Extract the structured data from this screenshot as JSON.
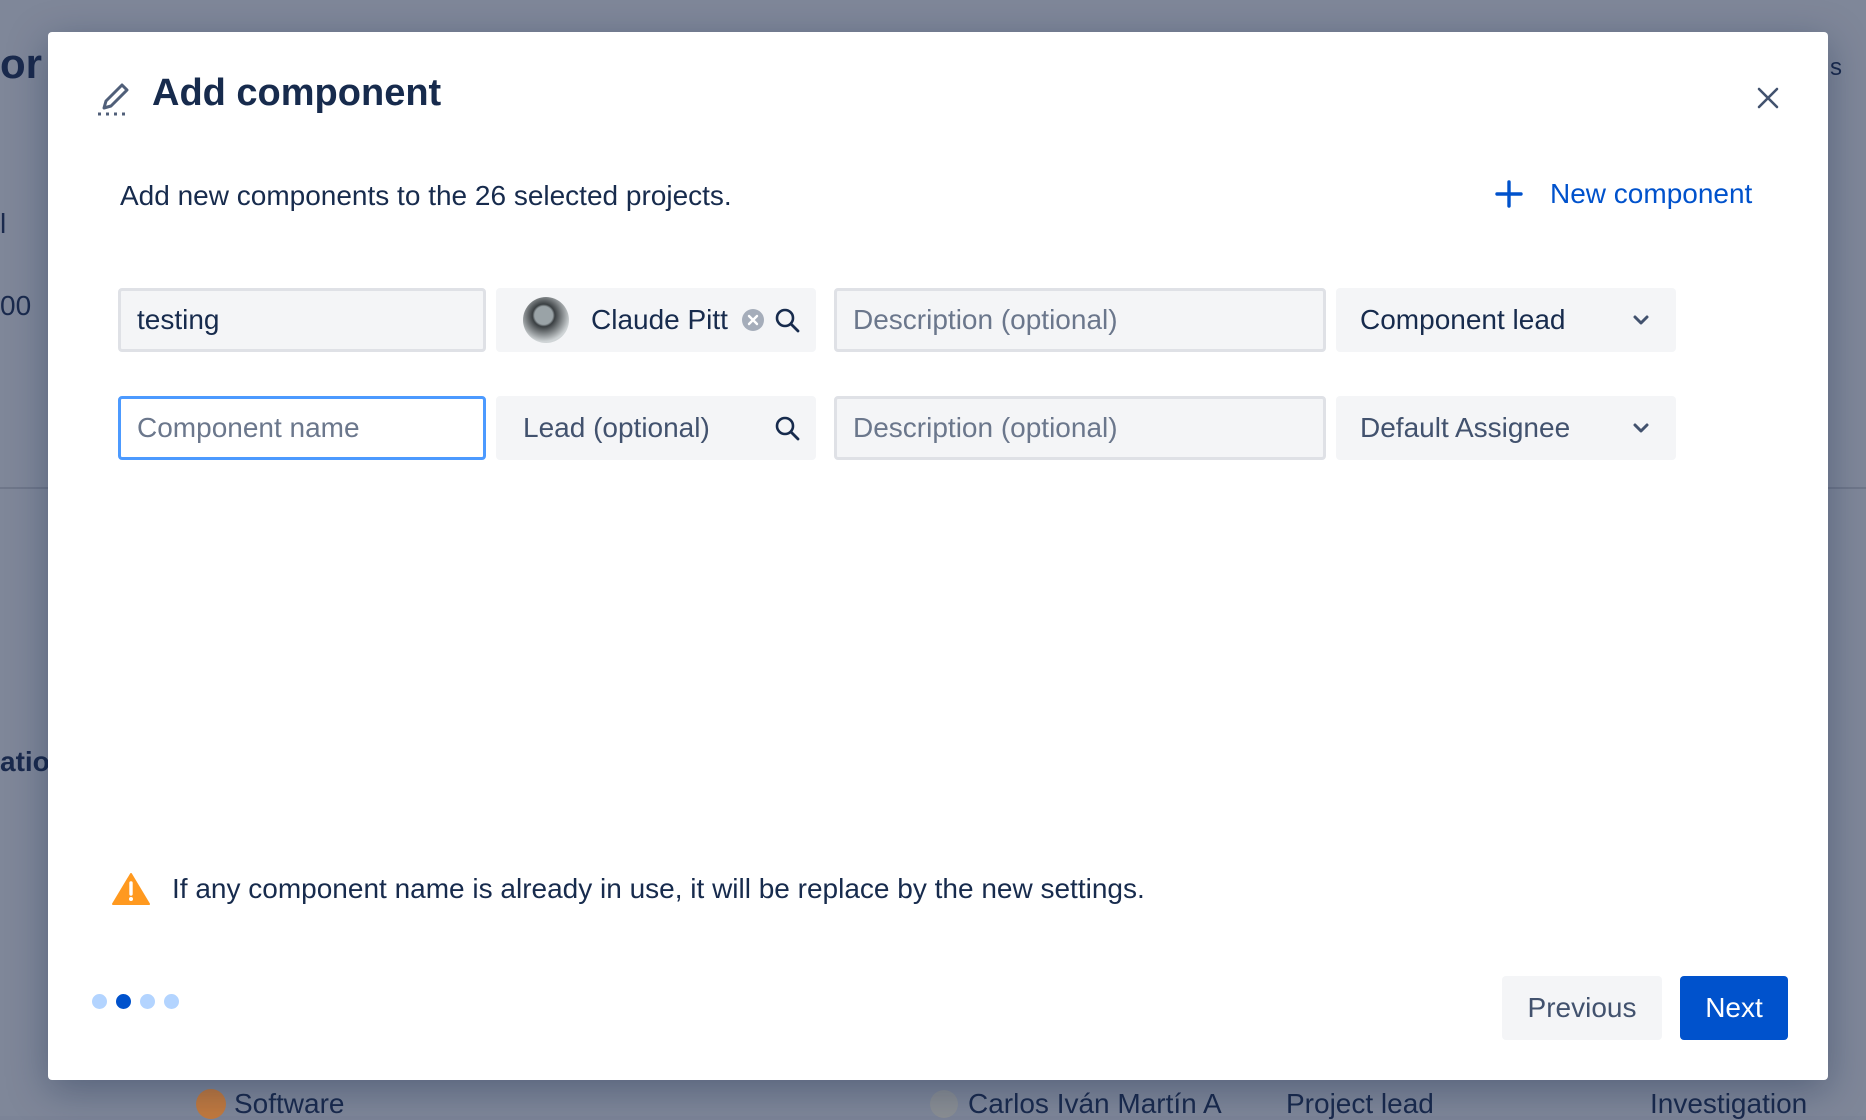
{
  "background": {
    "fragments": [
      "or",
      "l",
      "00",
      "atio",
      "s"
    ],
    "footer": {
      "software": "Software",
      "person": "Carlos Iván Martín A",
      "role": "Project lead",
      "category": "Investigation"
    }
  },
  "dialog": {
    "icon": "edit-pencil-icon",
    "title": "Add component",
    "intro": "Add new components to the 26 selected projects.",
    "new_component_label": "New component",
    "rows": [
      {
        "name_value": "testing",
        "name_placeholder": "Component name",
        "lead_value": "Claude Pitt",
        "description_placeholder": "Description (optional)",
        "assignee_value": "Component lead"
      },
      {
        "name_value": "",
        "name_placeholder": "Component name",
        "lead_placeholder": "Lead (optional)",
        "description_placeholder": "Description (optional)",
        "assignee_value": "Default Assignee"
      }
    ],
    "warning": "If any component name is already in use, it will be replace by the new settings.",
    "steps": {
      "total": 4,
      "current": 2
    },
    "previous_label": "Previous",
    "next_label": "Next"
  },
  "colors": {
    "primary": "#0052cc",
    "focus_border": "#4c9aff",
    "warning": "#ff991f",
    "text": "#172b4d"
  }
}
